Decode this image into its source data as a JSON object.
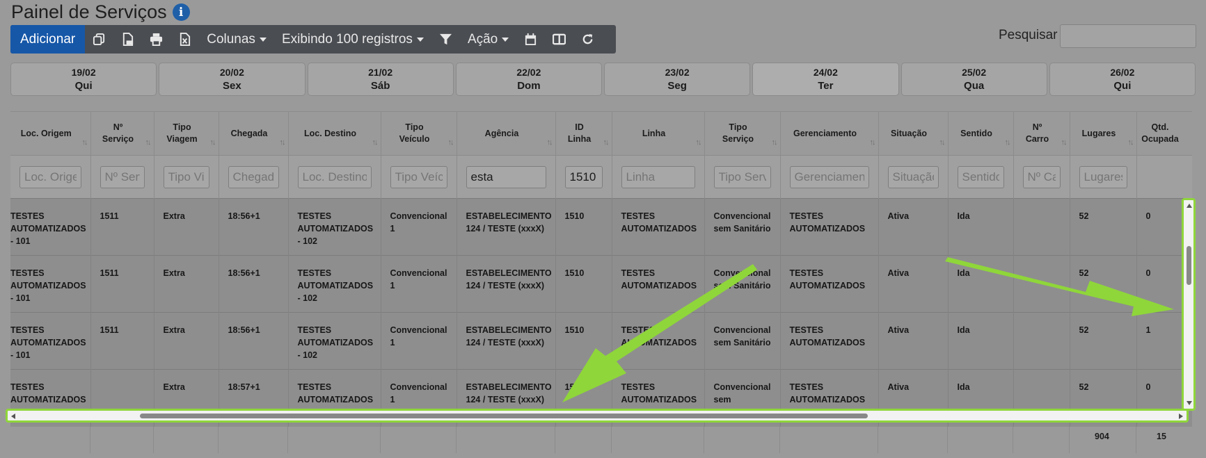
{
  "page": {
    "title": "Painel de Serviços"
  },
  "icons": {
    "info": "info-icon",
    "copy": "copy-icon",
    "pdf": "pdf-icon",
    "print": "print-icon",
    "excel": "excel-icon",
    "filter": "filter-icon",
    "calendar": "calendar-icon",
    "columns_view": "columns-view-icon",
    "refresh": "refresh-icon"
  },
  "toolbar": {
    "add_label": "Adicionar",
    "columns_label": "Colunas",
    "showing_label": "Exibindo 100 registros",
    "action_label": "Ação"
  },
  "search": {
    "label": "Pesquisar",
    "placeholder": ""
  },
  "days": [
    {
      "date": "19/02",
      "weekday": "Qui"
    },
    {
      "date": "20/02",
      "weekday": "Sex"
    },
    {
      "date": "21/02",
      "weekday": "Sáb"
    },
    {
      "date": "22/02",
      "weekday": "Dom"
    },
    {
      "date": "23/02",
      "weekday": "Seg"
    },
    {
      "date": "24/02",
      "weekday": "Ter"
    },
    {
      "date": "25/02",
      "weekday": "Qua"
    },
    {
      "date": "26/02",
      "weekday": "Qui"
    }
  ],
  "table": {
    "headers": [
      "Loc. Origem",
      "Nº Serviço",
      "Tipo Viagem",
      "Chegada",
      "Loc. Destino",
      "Tipo Veículo",
      "Agência",
      "ID Linha",
      "Linha",
      "Tipo Serviço",
      "Gerenciamento",
      "Situação",
      "Sentido",
      "Nº Carro",
      "Lugares",
      "Qtd. Ocupada"
    ],
    "header_lines": [
      [
        "Loc. Origem"
      ],
      [
        "Nº",
        "Serviço"
      ],
      [
        "Tipo",
        "Viagem"
      ],
      [
        "Chegada"
      ],
      [
        "Loc. Destino"
      ],
      [
        "Tipo",
        "Veículo"
      ],
      [
        "Agência"
      ],
      [
        "ID",
        "Linha"
      ],
      [
        "Linha"
      ],
      [
        "Tipo",
        "Serviço"
      ],
      [
        "Gerenciamento"
      ],
      [
        "Situação"
      ],
      [
        "Sentido"
      ],
      [
        "Nº",
        "Carro"
      ],
      [
        "Lugares"
      ],
      [
        "Qtd.",
        "Ocupada"
      ]
    ],
    "filters": [
      {
        "placeholder": "Loc. Origem",
        "value": ""
      },
      {
        "placeholder": "Nº Serviço",
        "value": ""
      },
      {
        "placeholder": "Tipo Viagem",
        "value": ""
      },
      {
        "placeholder": "Chegada",
        "value": ""
      },
      {
        "placeholder": "Loc. Destino",
        "value": ""
      },
      {
        "placeholder": "Tipo Veículo",
        "value": ""
      },
      {
        "placeholder": "Agência",
        "value": "esta"
      },
      {
        "placeholder": "ID Linha",
        "value": "1510"
      },
      {
        "placeholder": "Linha",
        "value": ""
      },
      {
        "placeholder": "Tipo Serviço",
        "value": ""
      },
      {
        "placeholder": "Gerenciamento",
        "value": ""
      },
      {
        "placeholder": "Situação",
        "value": ""
      },
      {
        "placeholder": "Sentido",
        "value": ""
      },
      {
        "placeholder": "Nº Carro",
        "value": ""
      },
      {
        "placeholder": "Lugares",
        "value": ""
      }
    ],
    "rows": [
      [
        "TESTES AUTOMATIZADOS - 101",
        "1511",
        "Extra",
        "18:56+1",
        "TESTES AUTOMATIZADOS - 102",
        "Convencional 1",
        "ESTABELECIMENTO 124 / TESTE (xxxX)",
        "1510",
        "TESTES AUTOMATIZADOS",
        "Convencional sem Sanitário",
        "TESTES AUTOMATIZADOS",
        "Ativa",
        "Ida",
        "",
        "52",
        "0"
      ],
      [
        "TESTES AUTOMATIZADOS - 101",
        "1511",
        "Extra",
        "18:56+1",
        "TESTES AUTOMATIZADOS - 102",
        "Convencional 1",
        "ESTABELECIMENTO 124 / TESTE (xxxX)",
        "1510",
        "TESTES AUTOMATIZADOS",
        "Convencional sem Sanitário",
        "TESTES AUTOMATIZADOS",
        "Ativa",
        "Ida",
        "",
        "52",
        "0"
      ],
      [
        "TESTES AUTOMATIZADOS - 101",
        "1511",
        "Extra",
        "18:56+1",
        "TESTES AUTOMATIZADOS - 102",
        "Convencional 1",
        "ESTABELECIMENTO 124 / TESTE (xxxX)",
        "1510",
        "TESTES AUTOMATIZADOS",
        "Convencional sem Sanitário",
        "TESTES AUTOMATIZADOS",
        "Ativa",
        "Ida",
        "",
        "52",
        "1"
      ],
      [
        "TESTES AUTOMATIZADOS",
        "",
        "Extra",
        "18:57+1",
        "TESTES AUTOMATIZADOS",
        "Convencional 1",
        "ESTABELECIMENTO 124 / TESTE (xxxX)",
        "15",
        "TESTES AUTOMATIZADOS",
        "Convencional sem",
        "TESTES AUTOMATIZADOS",
        "Ativa",
        "Ida",
        "",
        "52",
        "0"
      ]
    ],
    "totals": {
      "lugares": "904",
      "ocupada": "15"
    }
  }
}
